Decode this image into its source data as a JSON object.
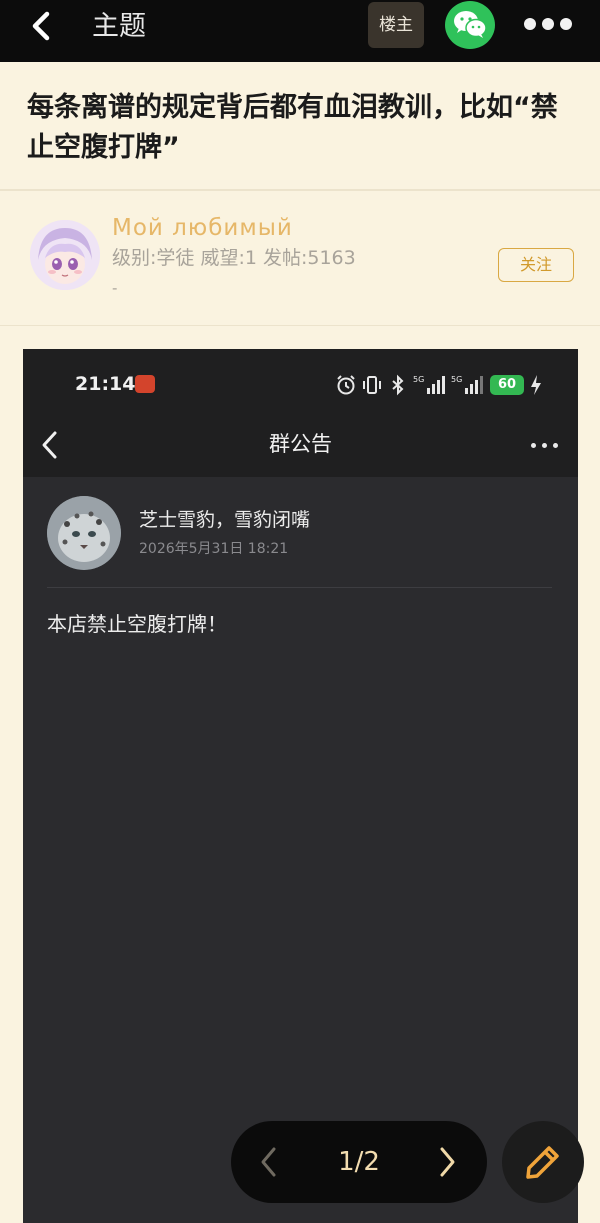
{
  "topbar": {
    "title": "主题",
    "author_badge": "楼主"
  },
  "post": {
    "title": "每条离谱的规定背后都有血泪教训，比如“禁止空腹打牌”"
  },
  "user": {
    "name": "Мой любимый",
    "info": "级别:学徒 威望:1 发帖:5163",
    "signature": "-",
    "follow_label": "关注"
  },
  "screenshot": {
    "status_time": "21:14",
    "battery_level": "60",
    "nav_title": "群公告",
    "author": "芝士雪豹，雪豹闭嘴",
    "date": "2026年5月31日 18:21",
    "body": "本店禁止空腹打牌！"
  },
  "pager": {
    "label": "1/2"
  },
  "colors": {
    "accent": "#d9a843",
    "wechat": "#2fc25a",
    "page_bg": "#faf3e0"
  }
}
